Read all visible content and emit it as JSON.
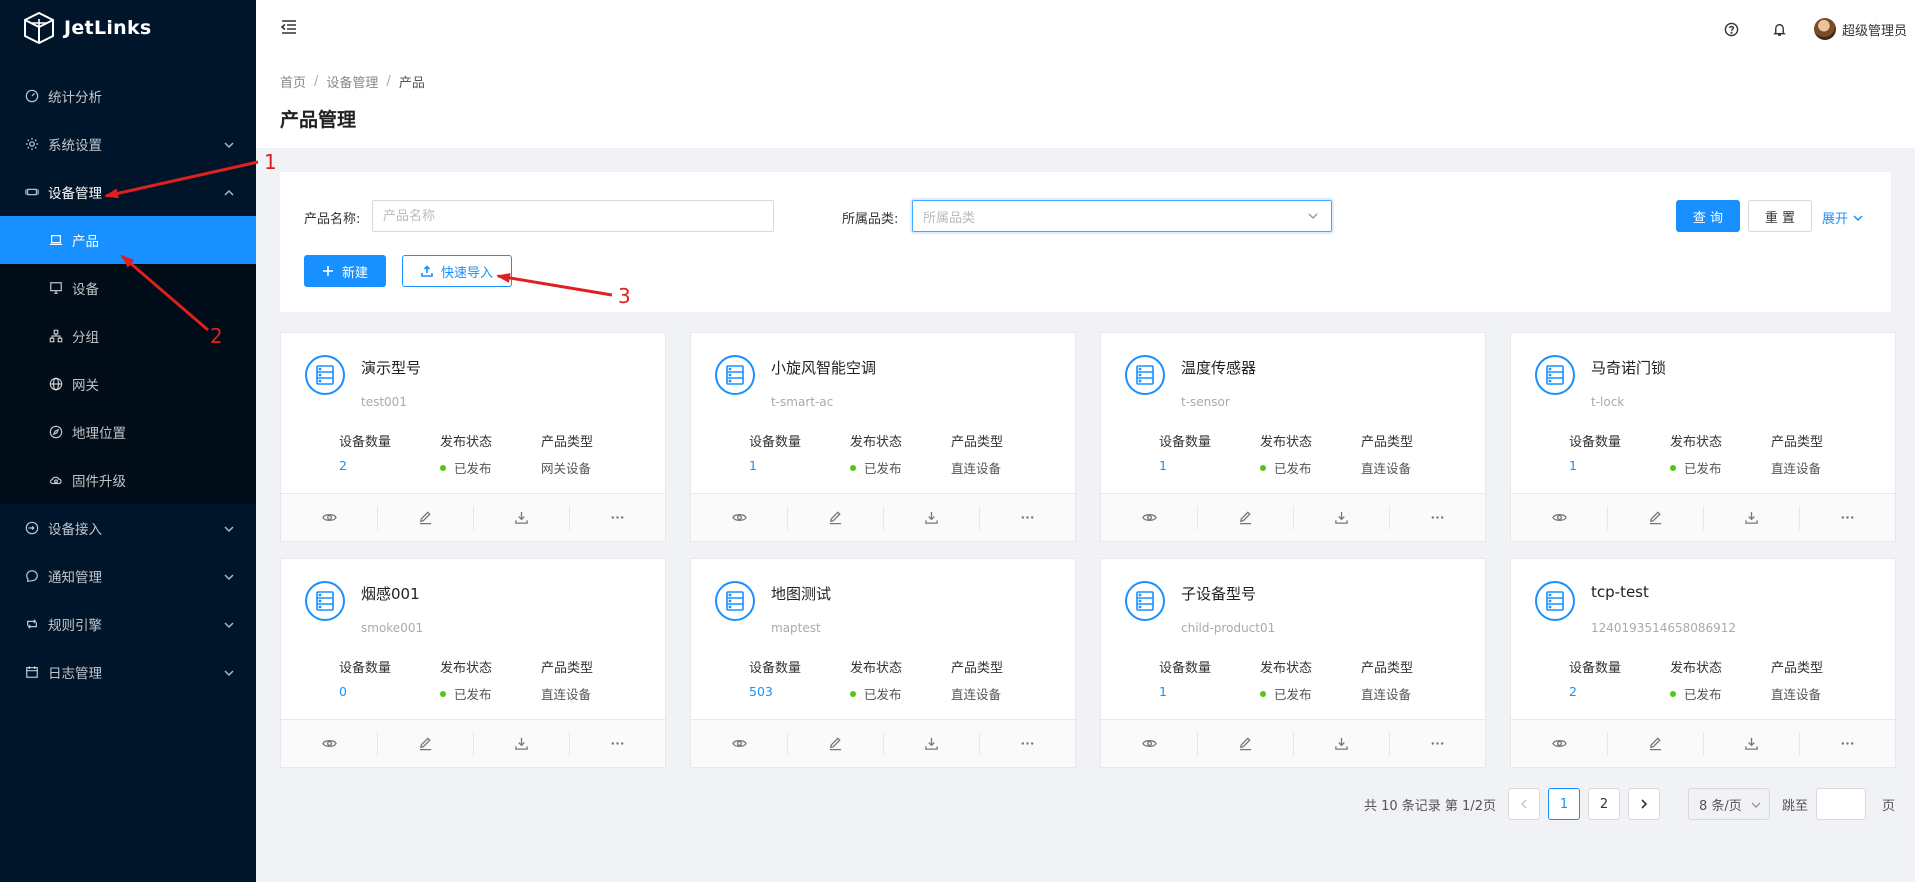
{
  "app": {
    "logo_text": "JetLinks"
  },
  "sidebar": {
    "items": [
      {
        "label": "统计分析",
        "icon": "dashboard-icon"
      },
      {
        "label": "系统设置",
        "icon": "gear-icon"
      },
      {
        "label": "设备管理",
        "icon": "device-manage-icon",
        "children": [
          {
            "label": "产品",
            "icon": "laptop-icon",
            "active": true
          },
          {
            "label": "设备",
            "icon": "desktop-icon"
          },
          {
            "label": "分组",
            "icon": "cluster-icon"
          },
          {
            "label": "网关",
            "icon": "globe-icon"
          },
          {
            "label": "地理位置",
            "icon": "compass-icon"
          },
          {
            "label": "固件升级",
            "icon": "cloud-sync-icon"
          }
        ]
      },
      {
        "label": "设备接入",
        "icon": "login-icon"
      },
      {
        "label": "通知管理",
        "icon": "message-icon"
      },
      {
        "label": "规则引擎",
        "icon": "retweet-icon"
      },
      {
        "label": "日志管理",
        "icon": "calendar-icon"
      }
    ]
  },
  "header": {
    "username": "超级管理员"
  },
  "breadcrumb": [
    "首页",
    "设备管理",
    "产品"
  ],
  "page_title": "产品管理",
  "search": {
    "name_label": "产品名称:",
    "name_placeholder": "产品名称",
    "category_label": "所属品类:",
    "category_placeholder": "所属品类",
    "query_label": "查 询",
    "reset_label": "重 置",
    "expand_label": "展开",
    "new_label": "新建",
    "import_label": "快速导入"
  },
  "card_labels": {
    "count": "设备数量",
    "status": "发布状态",
    "type": "产品类型"
  },
  "products": [
    {
      "name": "演示型号",
      "id": "test001",
      "count": "2",
      "status": "已发布",
      "type": "网关设备"
    },
    {
      "name": "小旋风智能空调",
      "id": "t-smart-ac",
      "count": "1",
      "status": "已发布",
      "type": "直连设备"
    },
    {
      "name": "温度传感器",
      "id": "t-sensor",
      "count": "1",
      "status": "已发布",
      "type": "直连设备"
    },
    {
      "name": "马奇诺门锁",
      "id": "t-lock",
      "count": "1",
      "status": "已发布",
      "type": "直连设备"
    },
    {
      "name": "烟感001",
      "id": "smoke001",
      "count": "0",
      "status": "已发布",
      "type": "直连设备"
    },
    {
      "name": "地图测试",
      "id": "maptest",
      "count": "503",
      "status": "已发布",
      "type": "直连设备"
    },
    {
      "name": "子设备型号",
      "id": "child-product01",
      "count": "1",
      "status": "已发布",
      "type": "直连设备"
    },
    {
      "name": "tcp-test",
      "id": "1240193514658086912",
      "count": "2",
      "status": "已发布",
      "type": "直连设备"
    }
  ],
  "pagination": {
    "total_text": "共 10 条记录 第 1/2页",
    "pages": [
      "1",
      "2"
    ],
    "current": "1",
    "page_size": "8 条/页",
    "jump_label": "跳至",
    "jump_suffix": "页"
  },
  "annotations": {
    "n1": "1",
    "n2": "2",
    "n3": "3",
    "color": "#e02020"
  }
}
